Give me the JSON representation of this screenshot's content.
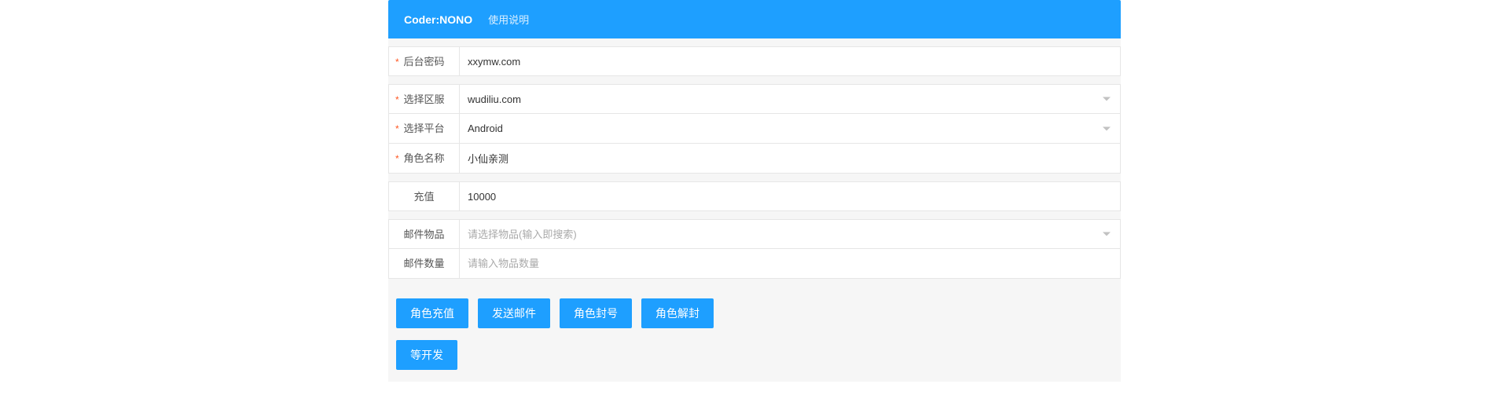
{
  "header": {
    "title": "Coder:NONO",
    "link": "使用说明"
  },
  "fields": {
    "password": {
      "label": "后台密码",
      "value": "xxymw.com",
      "required": true
    },
    "server": {
      "label": "选择区服",
      "value": "wudiliu.com",
      "required": true
    },
    "platform": {
      "label": "选择平台",
      "value": "Android",
      "required": true
    },
    "roleName": {
      "label": "角色名称",
      "value": "小仙亲测",
      "required": true
    },
    "recharge": {
      "label": "充值",
      "value": "10000",
      "required": false
    },
    "mailItem": {
      "label": "邮件物品",
      "placeholder": "请选择物品(输入即搜索)",
      "required": false
    },
    "mailQty": {
      "label": "邮件数量",
      "placeholder": "请输入物品数量",
      "required": false
    }
  },
  "buttons": {
    "recharge": "角色充值",
    "sendMail": "发送邮件",
    "ban": "角色封号",
    "unban": "角色解封",
    "dev": "等开发"
  },
  "requiredMark": "*"
}
